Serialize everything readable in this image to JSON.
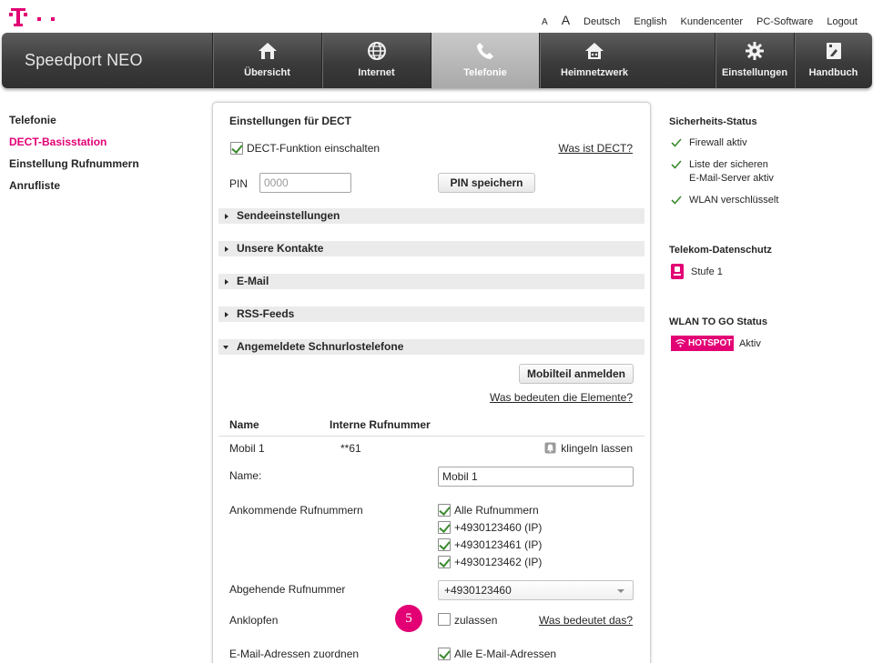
{
  "colors": {
    "magenta": "#e20074",
    "header_dark": "#3b3b3b",
    "check_green": "#3c8b2f"
  },
  "topnav": {
    "font_small": "A",
    "font_large": "A",
    "deutsch": "Deutsch",
    "english": "English",
    "kundencenter": "Kundencenter",
    "pc_software": "PC-Software",
    "logout": "Logout"
  },
  "header": {
    "brand": "Speedport NEO",
    "tabs": [
      {
        "label": "Übersicht",
        "icon": "home-icon"
      },
      {
        "label": "Internet",
        "icon": "globe-icon"
      },
      {
        "label": "Telefonie",
        "icon": "phone-icon"
      },
      {
        "label": "Heimnetzwerk",
        "icon": "network-house-icon"
      },
      {
        "label": "Einstellungen",
        "icon": "gear-icon"
      },
      {
        "label": "Handbuch",
        "icon": "manual-icon"
      }
    ],
    "active_tab": "Telefonie"
  },
  "sidebar": {
    "items": [
      "Telefonie",
      "DECT-Basisstation",
      "Einstellung Rufnummern",
      "Anrufliste"
    ],
    "active": "DECT-Basisstation"
  },
  "panel": {
    "title": "Einstellungen für DECT",
    "dect_enable_label": "DECT-Funktion einschalten",
    "dect_help_link": "Was ist DECT?",
    "pin_label": "PIN",
    "pin_placeholder": "0000",
    "pin_save_button": "PIN speichern",
    "sections": [
      {
        "label": "Sendeeinstellungen",
        "expanded": false
      },
      {
        "label": "Unsere Kontakte",
        "expanded": false
      },
      {
        "label": "E-Mail",
        "expanded": false
      },
      {
        "label": "RSS-Feeds",
        "expanded": false
      },
      {
        "label": "Angemeldete Schnurlostelefone",
        "expanded": true
      }
    ],
    "register_button": "Mobilteil anmelden",
    "elements_help_link": "Was bedeuten die Elemente?",
    "table_headers": {
      "name": "Name",
      "internal_number": "Interne Rufnummer"
    },
    "handset": {
      "name": "Mobil 1",
      "internal_number": "**61",
      "ring_action": "klingeln lassen",
      "name_label": "Name:",
      "name_value": "Mobil 1",
      "incoming_label": "Ankommende Rufnummern",
      "incoming_options": [
        {
          "label": "Alle Rufnummern",
          "checked": true
        },
        {
          "label": "+4930123460 (IP)",
          "checked": true
        },
        {
          "label": "+4930123461 (IP)",
          "checked": true
        },
        {
          "label": "+4930123462 (IP)",
          "checked": true
        }
      ],
      "outgoing_label": "Abgehende Rufnummer",
      "outgoing_value": "+4930123460",
      "call_waiting_label": "Anklopfen",
      "call_waiting_option": "zulassen",
      "call_waiting_help": "Was bedeutet das?",
      "email_assign_label": "E-Mail-Adressen zuordnen",
      "email_assign_option": "Alle E-Mail-Adressen"
    },
    "step_badge": "5"
  },
  "right": {
    "security_title": "Sicherheits-Status",
    "security_items": [
      "Firewall aktiv",
      "Liste der sicheren",
      "E-Mail-Server aktiv",
      "WLAN verschlüsselt"
    ],
    "privacy_title": "Telekom-Datenschutz",
    "privacy_level": "Stufe 1",
    "wlan_title": "WLAN TO GO Status",
    "hotspot_label": "HOTSPOT",
    "wlan_status": "Aktiv"
  }
}
